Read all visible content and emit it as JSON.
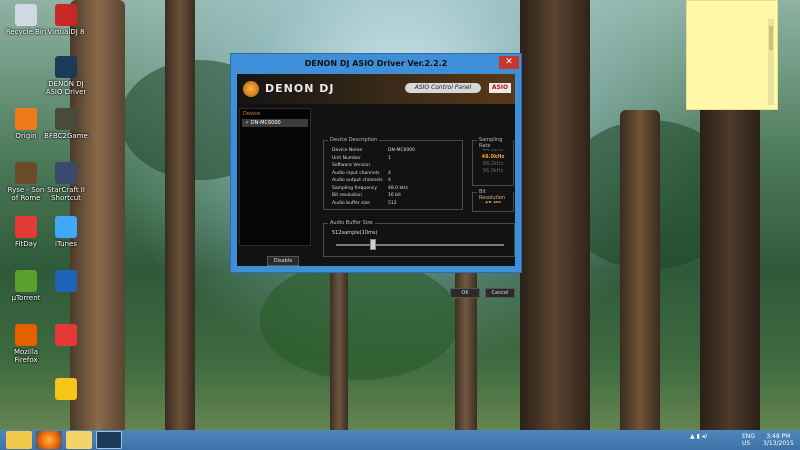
{
  "desktop": {
    "icons": [
      {
        "label": "Recycle Bin",
        "color": "#cfd8e3"
      },
      {
        "label": "VirtualDJ 8",
        "color": "#c62828"
      },
      {
        "label": "DENON DJ ASIO Driver",
        "color": "#1b3a57"
      },
      {
        "label": "Origin",
        "color": "#f07a1a"
      },
      {
        "label": "BFBC2Game",
        "color": "#4a4a3a"
      },
      {
        "label": "Ryse - Son of Rome",
        "color": "#6b4a2a"
      },
      {
        "label": "StarCraft II Shortcut",
        "color": "#3a4a6a"
      },
      {
        "label": "FitDay",
        "color": "#e53935"
      },
      {
        "label": "iTunes",
        "color": "#3fa9f5"
      },
      {
        "label": "µTorrent",
        "color": "#5aa02c"
      },
      {
        "label": "",
        "color": "#1f63b8"
      },
      {
        "label": "Mozilla Firefox",
        "color": "#e66000"
      },
      {
        "label": "",
        "color": "#e53935"
      },
      {
        "label": "",
        "color": "#f5c518"
      }
    ]
  },
  "window": {
    "title": "DENON DJ ASIO Driver Ver.2.2.2",
    "close_label": "✕",
    "brand": "DENON DJ",
    "control_panel_label": "ASIO Control Panel",
    "asio_badge": "ASIO",
    "device_list_header": "Device",
    "device_item": "✓ DN-MC6000",
    "disable_label": "Disable",
    "description_title": "Device Description",
    "description_rows": [
      {
        "key": "Device Name",
        "value": "DN-MC6000"
      },
      {
        "key": "Unit Number",
        "value": "1"
      },
      {
        "key": "Software Version",
        "value": ""
      },
      {
        "key": "Audio input channels",
        "value": "4"
      },
      {
        "key": "Audio output channels",
        "value": "4"
      },
      {
        "key": "Sampling frequency",
        "value": "48.0 kHz"
      },
      {
        "key": "Bit resolution",
        "value": "16 bit"
      },
      {
        "key": "Audio buffer size",
        "value": "512"
      }
    ],
    "sampling_rate_title": "Sampling Rate",
    "sampling_rates": [
      "44.1kHz",
      "48.0kHz",
      "88.2kHz",
      "96.0kHz"
    ],
    "selected_rate": "48.0kHz",
    "bit_resolution_title": "Bit Resolution",
    "bit_resolution_value": "16 bit",
    "buffer_title": "Audio Buffer Size",
    "buffer_value": "512sample(10ms)",
    "ok_label": "OK",
    "cancel_label": "Cancel"
  },
  "taskbar": {
    "apps": [
      "file-explorer",
      "firefox",
      "folder",
      "denon-asio"
    ],
    "language": "ENG",
    "region": "US",
    "time": "3:48 PM",
    "date": "3/13/2015"
  }
}
